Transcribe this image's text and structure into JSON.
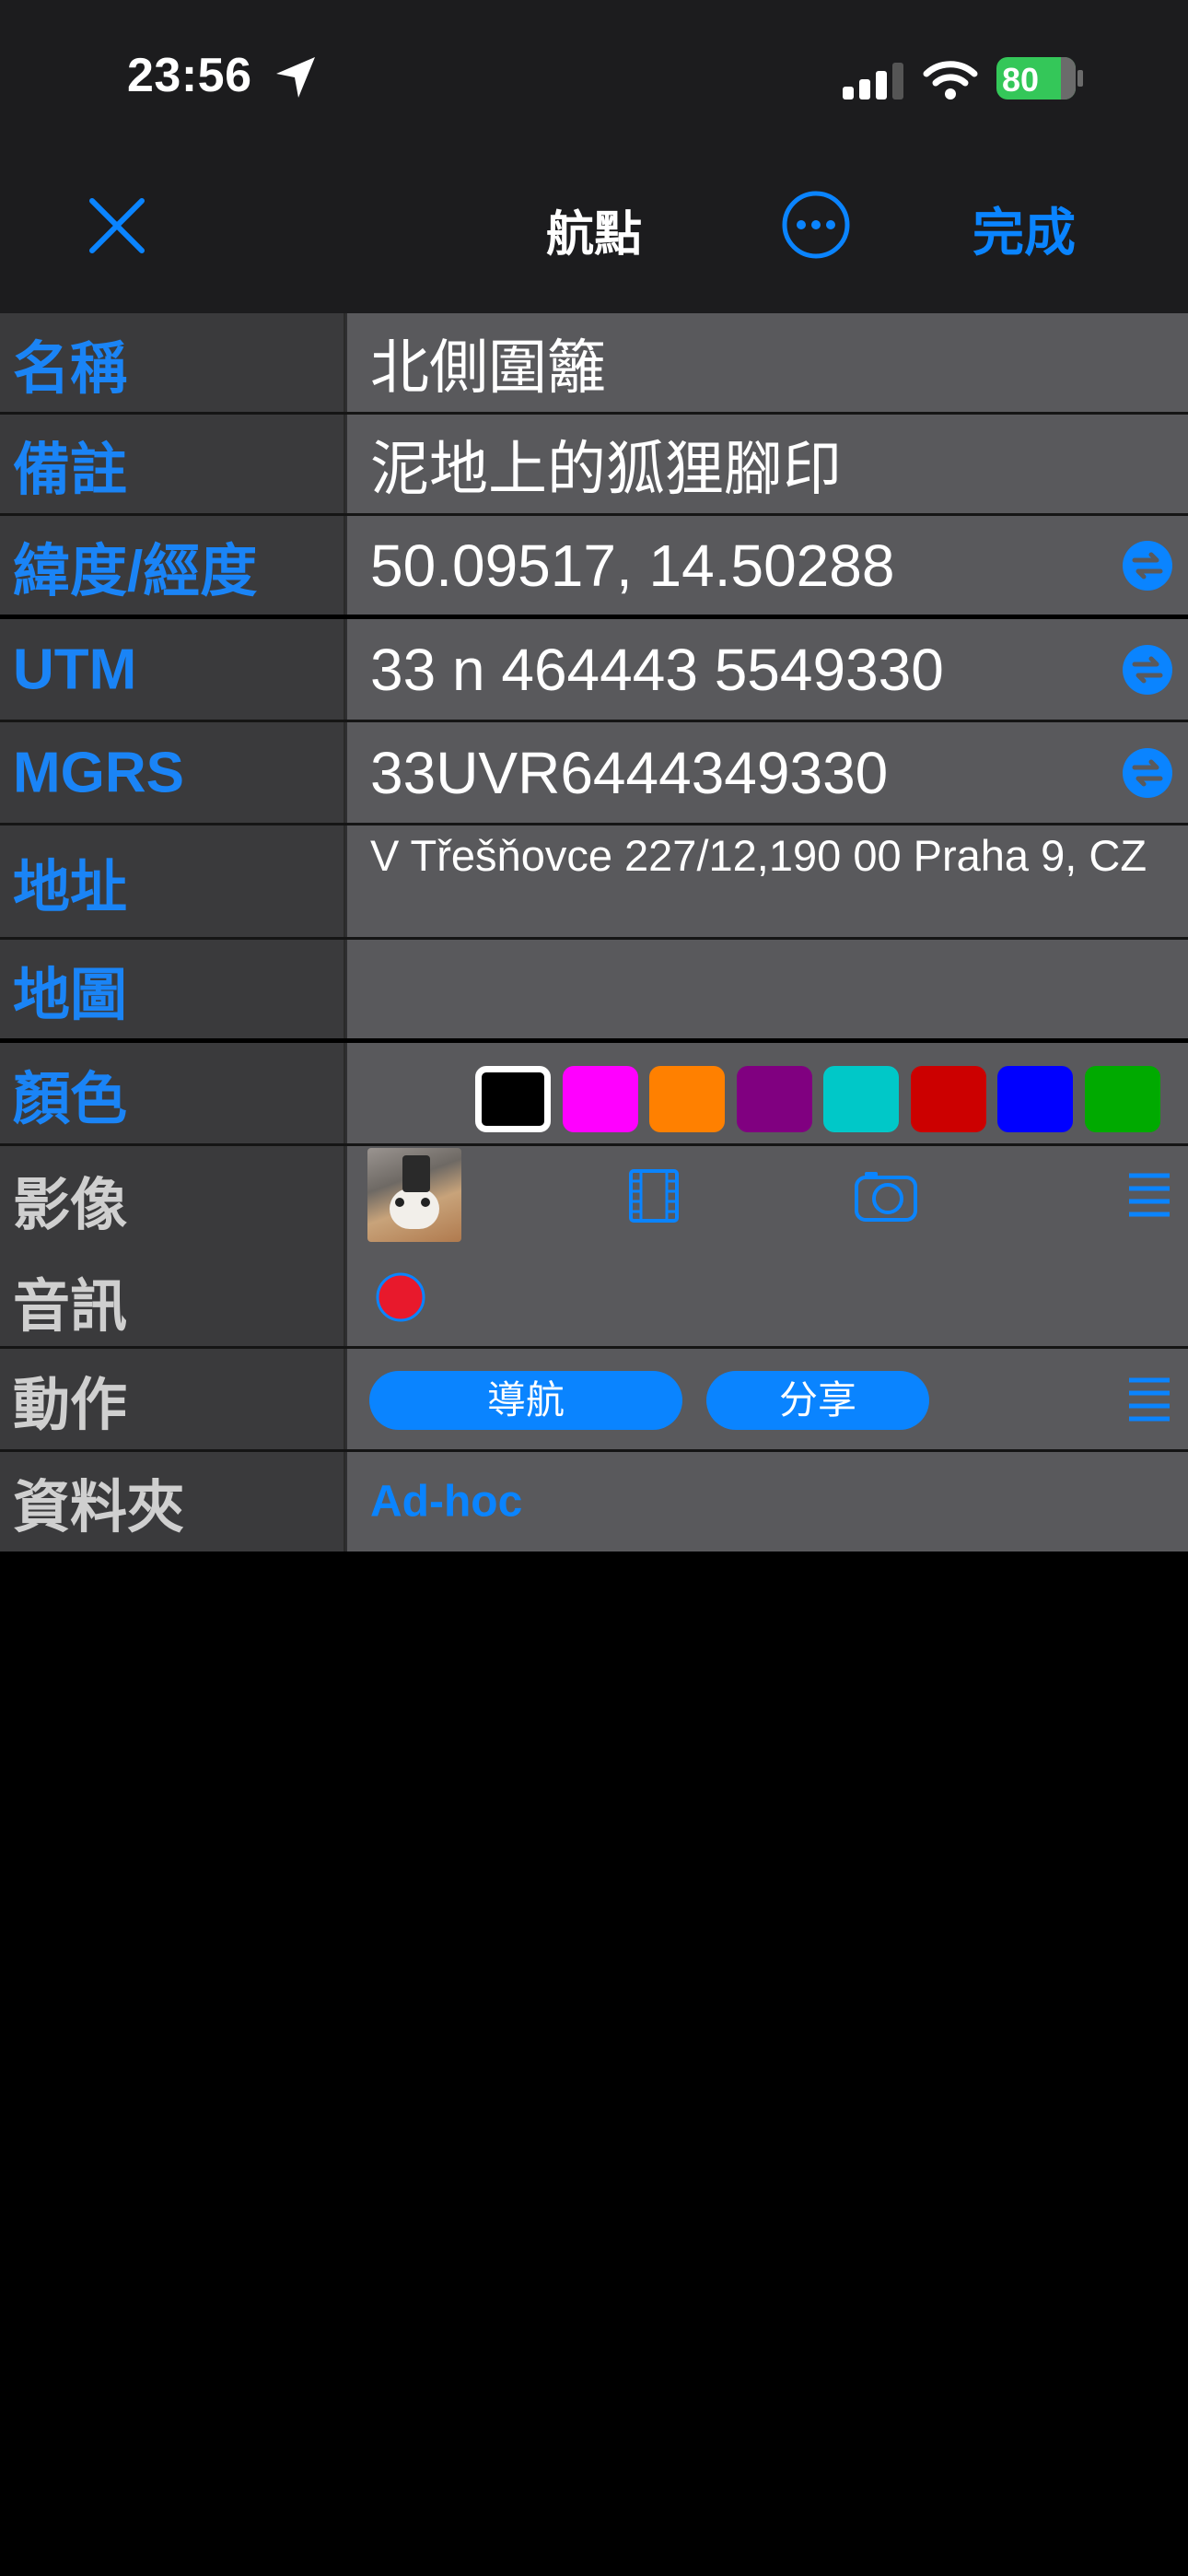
{
  "status_bar": {
    "time": "23:56",
    "battery": "80"
  },
  "nav": {
    "title": "航點",
    "done_label": "完成"
  },
  "rows": {
    "name": {
      "label": "名稱",
      "value": "北側圍籬"
    },
    "note": {
      "label": "備註",
      "value": "泥地上的狐狸腳印"
    },
    "latlon": {
      "label": "緯度/經度",
      "value": "50.09517, 14.50288"
    },
    "utm": {
      "label": "UTM",
      "value": "33 n 464443 5549330"
    },
    "mgrs": {
      "label": "MGRS",
      "value": "33UVR6444349330"
    },
    "address": {
      "label": "地址",
      "value": "V Třešňovce 227/12,190 00 Praha 9, CZ"
    },
    "map": {
      "label": "地圖",
      "value": ""
    },
    "color": {
      "label": "顏色"
    },
    "image": {
      "label": "影像"
    },
    "audio": {
      "label": "音訊"
    },
    "action": {
      "label": "動作",
      "navigate": "導航",
      "share": "分享"
    },
    "folder": {
      "label": "資料夾",
      "value": "Ad-hoc"
    }
  },
  "colors": [
    "#000000",
    "#ff00ff",
    "#ff8000",
    "#800080",
    "#00c8c8",
    "#cc0000",
    "#0000ff",
    "#00aa00"
  ],
  "accent": "#0a84ff",
  "icons": [
    "location-arrow-icon",
    "signal-icon",
    "wifi-icon",
    "battery-icon",
    "close-icon",
    "more-icon",
    "swap-icon",
    "film-icon",
    "camera-icon",
    "menu-icon",
    "record-icon"
  ]
}
